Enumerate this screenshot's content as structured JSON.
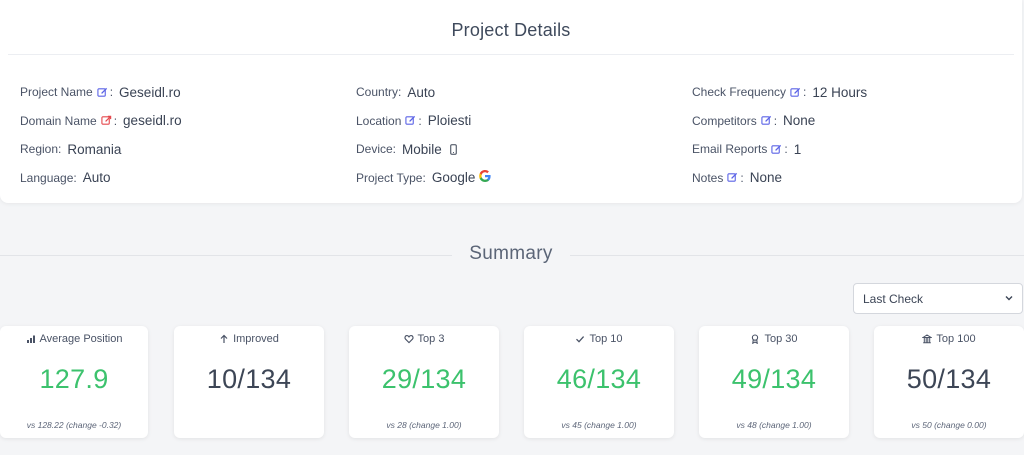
{
  "project_details": {
    "title": "Project Details",
    "left": [
      {
        "label": "Project Name",
        "icon": "edit-icon",
        "colon": ":",
        "value": "Geseidl.ro"
      },
      {
        "label": "Domain Name",
        "icon": "external-link-icon",
        "colon": ":",
        "value": "geseidl.ro"
      },
      {
        "label": "Region:",
        "value": "Romania"
      },
      {
        "label": "Language:",
        "value": "Auto"
      }
    ],
    "middle": [
      {
        "label": "Country:",
        "value": "Auto"
      },
      {
        "label": "Location",
        "icon": "edit-icon",
        "colon": ":",
        "value": "Ploiesti"
      },
      {
        "label": "Device:",
        "value": "Mobile",
        "value_icon": "mobile-icon"
      },
      {
        "label": "Project Type:",
        "value": "Google",
        "value_icon": "google-icon"
      }
    ],
    "right": [
      {
        "label": "Check Frequency",
        "icon": "edit-icon",
        "colon": ":",
        "value": "12 Hours"
      },
      {
        "label": "Competitors",
        "icon": "edit-icon",
        "colon": ":",
        "value": "None"
      },
      {
        "label": "Email Reports",
        "icon": "edit-icon",
        "colon": ":",
        "value": "1"
      },
      {
        "label": "Notes",
        "icon": "edit-icon",
        "colon": ":",
        "value": "None"
      }
    ]
  },
  "summary": {
    "title": "Summary",
    "period_select": {
      "selected": "Last Check"
    },
    "cards": [
      {
        "icon": "bar-chart-icon",
        "label": "Average Position",
        "value": "127.9",
        "sub": "vs 128.22 (change -0.32)",
        "tone": "green"
      },
      {
        "icon": "arrow-up-icon",
        "label": "Improved",
        "value": "10/134",
        "sub": "",
        "tone": "dark"
      },
      {
        "icon": "heart-icon",
        "label": "Top 3",
        "value": "29/134",
        "sub": "vs 28 (change 1.00)",
        "tone": "green"
      },
      {
        "icon": "check-icon",
        "label": "Top 10",
        "value": "46/134",
        "sub": "vs 45 (change 1.00)",
        "tone": "green"
      },
      {
        "icon": "award-icon",
        "label": "Top 30",
        "value": "49/134",
        "sub": "vs 48 (change 1.00)",
        "tone": "green"
      },
      {
        "icon": "building-icon",
        "label": "Top 100",
        "value": "50/134",
        "sub": "vs 50 (change 0.00)",
        "tone": "dark"
      }
    ]
  },
  "colors": {
    "accent": "#5b63e6",
    "external": "#e5484d",
    "positive": "#3cc26d",
    "text": "#3b4455"
  }
}
